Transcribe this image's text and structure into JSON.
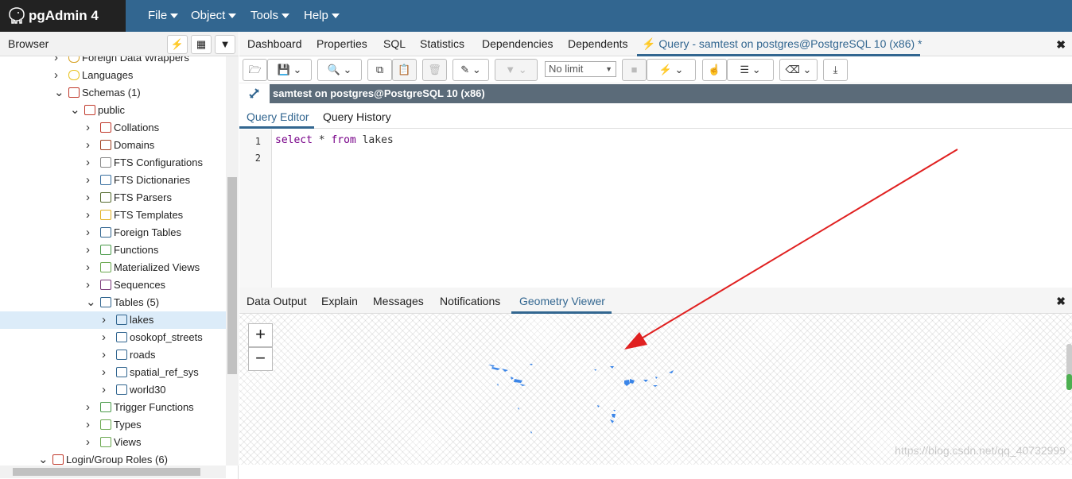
{
  "app": {
    "title": "pgAdmin 4"
  },
  "menu": {
    "file": "File",
    "object": "Object",
    "tools": "Tools",
    "help": "Help"
  },
  "browser": {
    "title": "Browser",
    "tree": [
      {
        "label": "Foreign Data Wrappers",
        "level": 2,
        "state": "collapsed",
        "icon": "fdw-icon"
      },
      {
        "label": "Languages",
        "level": 2,
        "state": "collapsed",
        "icon": "languages-icon"
      },
      {
        "label": "Schemas (1)",
        "level": 2,
        "state": "expanded",
        "icon": "schemas-icon"
      },
      {
        "label": "public",
        "level": 3,
        "state": "expanded",
        "icon": "schema-icon"
      },
      {
        "label": "Collations",
        "level": 4,
        "state": "collapsed",
        "icon": "collations-icon"
      },
      {
        "label": "Domains",
        "level": 4,
        "state": "collapsed",
        "icon": "domains-icon"
      },
      {
        "label": "FTS Configurations",
        "level": 4,
        "state": "collapsed",
        "icon": "fts-config-icon"
      },
      {
        "label": "FTS Dictionaries",
        "level": 4,
        "state": "collapsed",
        "icon": "fts-dict-icon"
      },
      {
        "label": "FTS Parsers",
        "level": 4,
        "state": "collapsed",
        "icon": "fts-parser-icon"
      },
      {
        "label": "FTS Templates",
        "level": 4,
        "state": "collapsed",
        "icon": "fts-template-icon"
      },
      {
        "label": "Foreign Tables",
        "level": 4,
        "state": "collapsed",
        "icon": "foreign-table-icon"
      },
      {
        "label": "Functions",
        "level": 4,
        "state": "collapsed",
        "icon": "functions-icon"
      },
      {
        "label": "Materialized Views",
        "level": 4,
        "state": "collapsed",
        "icon": "mview-icon"
      },
      {
        "label": "Sequences",
        "level": 4,
        "state": "collapsed",
        "icon": "sequences-icon"
      },
      {
        "label": "Tables (5)",
        "level": 4,
        "state": "expanded",
        "icon": "tables-icon"
      },
      {
        "label": "lakes",
        "level": 5,
        "state": "collapsed",
        "icon": "table-icon",
        "selected": true
      },
      {
        "label": "osokopf_streets",
        "level": 5,
        "state": "collapsed",
        "icon": "table-icon"
      },
      {
        "label": "roads",
        "level": 5,
        "state": "collapsed",
        "icon": "table-icon"
      },
      {
        "label": "spatial_ref_sys",
        "level": 5,
        "state": "collapsed",
        "icon": "table-icon"
      },
      {
        "label": "world30",
        "level": 5,
        "state": "collapsed",
        "icon": "table-icon"
      },
      {
        "label": "Trigger Functions",
        "level": 4,
        "state": "collapsed",
        "icon": "trigger-func-icon"
      },
      {
        "label": "Types",
        "level": 4,
        "state": "collapsed",
        "icon": "types-icon"
      },
      {
        "label": "Views",
        "level": 4,
        "state": "collapsed",
        "icon": "views-icon"
      },
      {
        "label": "Login/Group Roles (6)",
        "level": 1,
        "state": "expanded",
        "icon": "roles-icon"
      }
    ]
  },
  "tabs": {
    "dashboard": "Dashboard",
    "properties": "Properties",
    "sql": "SQL",
    "statistics": "Statistics",
    "dependencies": "Dependencies",
    "dependents": "Dependents",
    "query": "Query - samtest on postgres@PostgreSQL 10 (x86) *"
  },
  "toolbar": {
    "limit": "No limit"
  },
  "connection": {
    "label": "samtest on postgres@PostgreSQL 10 (x86)"
  },
  "editor_tabs": {
    "editor": "Query Editor",
    "history": "Query History"
  },
  "editor": {
    "lines": [
      "1",
      "2"
    ],
    "kw_select": "select",
    "star": " * ",
    "kw_from": "from",
    "table": " lakes"
  },
  "result_tabs": {
    "data_output": "Data Output",
    "explain": "Explain",
    "messages": "Messages",
    "notifications": "Notifications",
    "geometry_viewer": "Geometry Viewer"
  },
  "map": {
    "zoom_in": "+",
    "zoom_out": "−"
  },
  "watermark": "https://blog.csdn.net/qq_40732999",
  "colors": {
    "header": "#326690",
    "accent": "#326690",
    "geometry": "#3a85e8",
    "annotation": "#e02020"
  }
}
